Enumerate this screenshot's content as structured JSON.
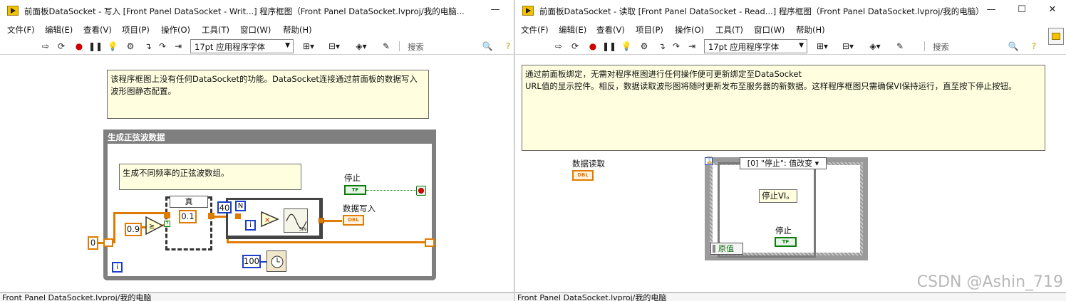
{
  "left_window": {
    "title": "前面板DataSocket - 写入 [Front Panel DataSocket - Writ...] 程序框图（Front Panel DataSocket.lvproj/我的电脑...",
    "menu": [
      "文件(F)",
      "编辑(E)",
      "查看(V)",
      "项目(P)",
      "操作(O)",
      "工具(T)",
      "窗口(W)",
      "帮助(H)"
    ],
    "font": "17pt 应用程序字体",
    "search_placeholder": "搜索",
    "top_note": "该程序框图上没有任何DataSocket的功能。DataSocket连接通过前面板的数据写入\n波形图静态配置。",
    "frame_title": "生成正弦波数据",
    "inner_note": "生成不同频率的正弦波数组。",
    "case_selector": "真",
    "const_zero": "0",
    "const_09": "0.9",
    "const_01": "0.1",
    "const_40": "40",
    "const_100": "100",
    "n_label": "N",
    "i_label": "i",
    "stop_label": "停止",
    "stop_term": "TF",
    "write_label": "数据写入",
    "write_term": "DBL",
    "sine_label": "SIN",
    "status": "Front Panel DataSocket.lvproj/我的电脑"
  },
  "right_window": {
    "title": "前面板DataSocket - 读取 [Front Panel DataSocket - Read...] 程序框图（Front Panel DataSocket.lvproj/我的电脑）",
    "menu": [
      "文件(F)",
      "编辑(E)",
      "查看(V)",
      "项目(P)",
      "操作(O)",
      "工具(T)",
      "窗口(W)",
      "帮助(H)"
    ],
    "font": "17pt 应用程序字体",
    "search_placeholder": "搜索",
    "top_note": "通过前面板绑定，无需对程序框图进行任何操作便可更新绑定至DataSocket\nURL值的显示控件。相反，数据读取波形图将随时更新发布至服务器的新数据。这样程序框图只需确保VI保持运行，直至按下停止按钮。",
    "read_label": "数据读取",
    "read_term": "DBL",
    "event_selector": "[0] \"停止\": 值改变",
    "stop_note": "停止VI。",
    "stop_label": "停止",
    "stop_term": "TF",
    "orig_value": "原值",
    "status": "Front Panel DataSocket.lvproj/我的电脑"
  },
  "watermark": "CSDN @Ashin_719"
}
